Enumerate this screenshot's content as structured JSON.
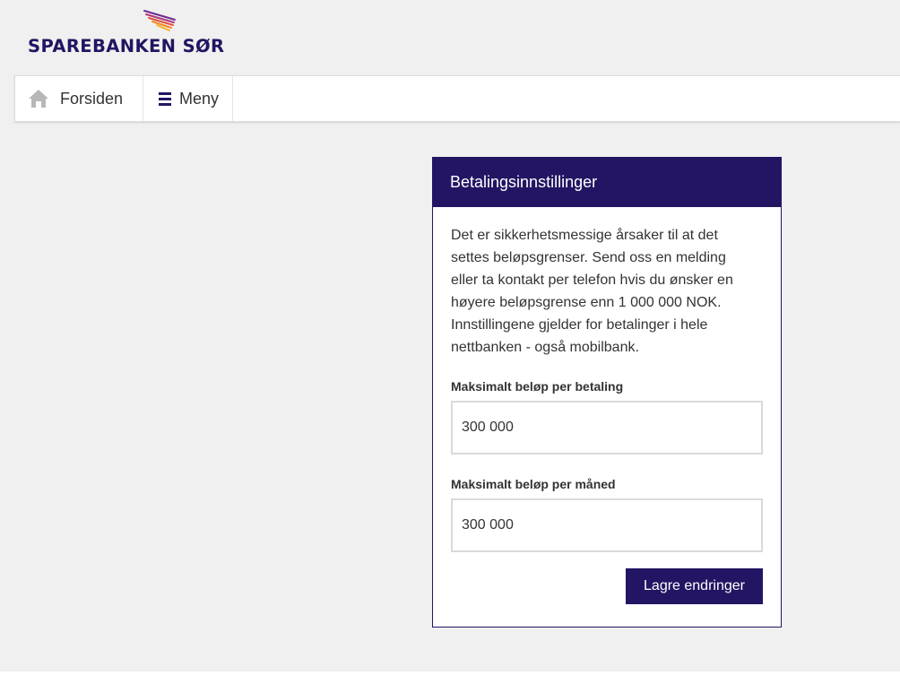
{
  "brand": {
    "name": "SPAREBANKEN SØR",
    "colors": {
      "primary": "#231563",
      "logo_stripes": [
        "#6b2c91",
        "#b03a7a",
        "#e0513f",
        "#f08a2a",
        "#f6b42c"
      ]
    }
  },
  "nav": {
    "items": [
      {
        "label": "Forsiden",
        "icon": "home-icon"
      },
      {
        "label": "Meny",
        "icon": "hamburger-menu-icon"
      }
    ]
  },
  "card": {
    "title": "Betalingsinnstillinger",
    "info": "Det er sikkerhetsmessige årsaker til at det settes beløpsgrenser. Send oss en melding eller ta kontakt per telefon hvis du ønsker en høyere beløpsgrense enn 1 000 000 NOK. Innstillingene gjelder for betalinger i hele nettbanken - også mobilbank.",
    "fields": [
      {
        "label": "Maksimalt beløp per betaling",
        "value": "300 000"
      },
      {
        "label": "Maksimalt beløp per måned",
        "value": "300 000"
      }
    ],
    "save_label": "Lagre endringer"
  }
}
